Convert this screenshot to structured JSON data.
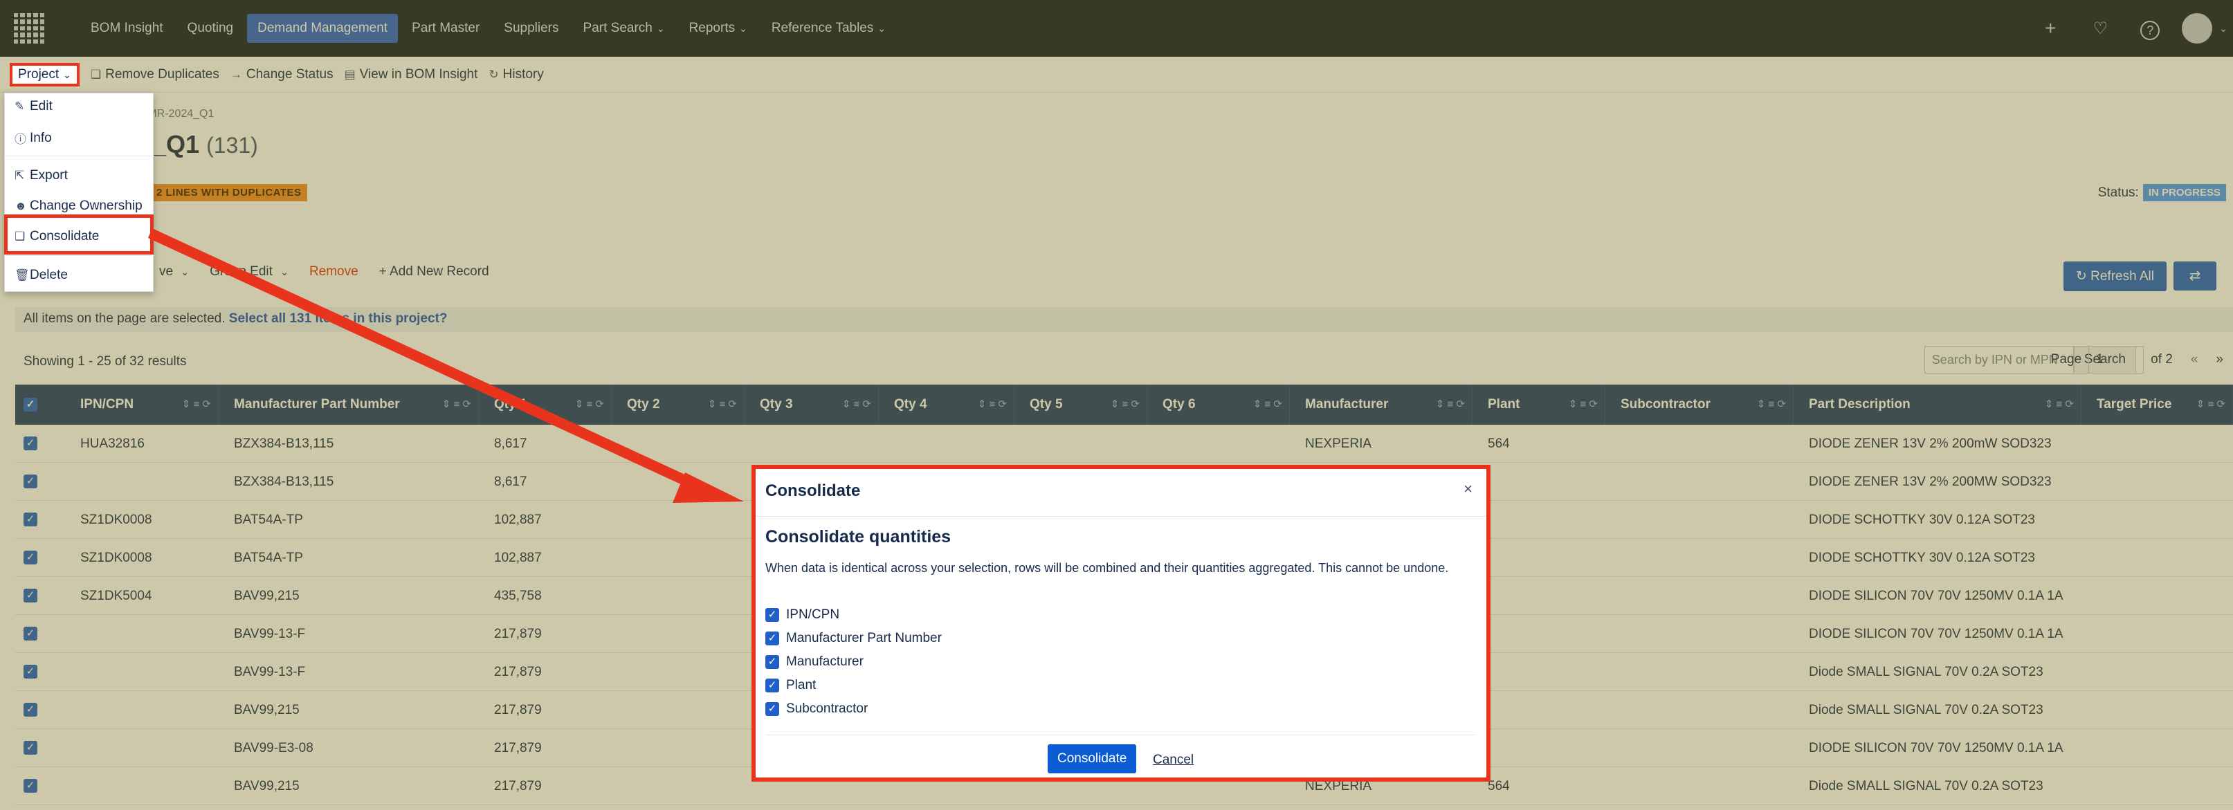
{
  "nav": {
    "items": [
      {
        "label": "BOM Insight",
        "dropdown": false
      },
      {
        "label": "Quoting",
        "dropdown": false
      },
      {
        "label": "Demand Management",
        "dropdown": false,
        "active": true
      },
      {
        "label": "Part Master",
        "dropdown": false
      },
      {
        "label": "Suppliers",
        "dropdown": false
      },
      {
        "label": "Part Search",
        "dropdown": true
      },
      {
        "label": "Reports",
        "dropdown": true
      },
      {
        "label": "Reference Tables",
        "dropdown": true
      }
    ],
    "caret": "⌄",
    "icons": {
      "add": "+",
      "bell": "🔔",
      "help": "?"
    }
  },
  "subbar": {
    "project": "Project",
    "remove_duplicates": "Remove Duplicates",
    "change_status": "Change Status",
    "view_bom": "View in BOM Insight",
    "history": "History"
  },
  "project": {
    "breadcrumb": "MMR-2024_Q1",
    "title": "4_Q1",
    "count": "(131)",
    "duplicates_badge": "2 LINES WITH DUPLICATES",
    "status_label": "Status:",
    "status_value": "IN PROGRESS"
  },
  "dropdown": {
    "edit": "Edit",
    "info": "Info",
    "export": "Export",
    "change_ownership": "Change Ownership",
    "consolidate": "Consolidate",
    "delete": "Delete"
  },
  "grid_toolbar": {
    "move": "ve",
    "group_edit": "Group Edit",
    "remove": "Remove",
    "add_record": "Add New Record",
    "refresh_all": "Refresh All"
  },
  "selection": {
    "message": "All items on the page are selected.",
    "link": "Select all 131 items in this project?"
  },
  "results": {
    "showing": "Showing 1 - 25 of 32 results",
    "search_placeholder": "Search by IPN or MPN",
    "search_button": "Search",
    "page_label": "Page",
    "page_value": "1",
    "page_of": "of 2",
    "prev": "«",
    "next": "»"
  },
  "table": {
    "columns": [
      "IPN/CPN",
      "Manufacturer Part Number",
      "Qty 1",
      "Qty 2",
      "Qty 3",
      "Qty 4",
      "Qty 5",
      "Qty 6",
      "Manufacturer",
      "Plant",
      "Subcontractor",
      "Part Description",
      "Target Price"
    ],
    "rows": [
      {
        "ipn": "HUA32816",
        "mpn": "BZX384-B13,115",
        "qty1": "8,617",
        "mfr": "NEXPERIA",
        "plant": "564",
        "desc": "DIODE ZENER 13V 2% 200mW SOD323"
      },
      {
        "ipn": "",
        "mpn": "BZX384-B13,115",
        "qty1": "8,617",
        "mfr": "",
        "plant": "",
        "desc": "DIODE ZENER 13V 2% 200MW SOD323"
      },
      {
        "ipn": "SZ1DK0008",
        "mpn": "BAT54A-TP",
        "qty1": "102,887",
        "mfr": "",
        "plant": "",
        "desc": "DIODE SCHOTTKY 30V 0.12A SOT23"
      },
      {
        "ipn": "SZ1DK0008",
        "mpn": "BAT54A-TP",
        "qty1": "102,887",
        "mfr": "",
        "plant": "",
        "desc": "DIODE SCHOTTKY 30V 0.12A SOT23"
      },
      {
        "ipn": "SZ1DK5004",
        "mpn": "BAV99,215",
        "qty1": "435,758",
        "mfr": "",
        "plant": "",
        "desc": "DIODE SILICON 70V 70V 1250MV 0.1A 1A"
      },
      {
        "ipn": "",
        "mpn": "BAV99-13-F",
        "qty1": "217,879",
        "mfr": "",
        "plant": "",
        "desc": "DIODE SILICON 70V 70V 1250MV 0.1A 1A"
      },
      {
        "ipn": "",
        "mpn": "BAV99-13-F",
        "qty1": "217,879",
        "mfr": "",
        "plant": "",
        "desc": "Diode SMALL SIGNAL 70V 0.2A SOT23"
      },
      {
        "ipn": "",
        "mpn": "BAV99,215",
        "qty1": "217,879",
        "mfr": "",
        "plant": "",
        "desc": "Diode SMALL SIGNAL 70V 0.2A SOT23"
      },
      {
        "ipn": "",
        "mpn": "BAV99-E3-08",
        "qty1": "217,879",
        "mfr": "",
        "plant": "",
        "desc": "DIODE SILICON 70V 70V 1250MV 0.1A 1A"
      },
      {
        "ipn": "",
        "mpn": "BAV99,215",
        "qty1": "217,879",
        "mfr": "NEXPERIA",
        "plant": "564",
        "desc": "Diode SMALL SIGNAL 70V 0.2A SOT23"
      }
    ]
  },
  "modal": {
    "title": "Consolidate",
    "close": "×",
    "heading": "Consolidate quantities",
    "description": "When data is identical across your selection, rows will be combined and their quantities aggregated. This cannot be undone.",
    "options": [
      "IPN/CPN",
      "Manufacturer Part Number",
      "Manufacturer",
      "Plant",
      "Subcontractor"
    ],
    "confirm": "Consolidate",
    "cancel": "Cancel"
  },
  "colors": {
    "nav_bg": "#0f1a2e",
    "active": "#2b5fcf",
    "primary": "#0b5bd3",
    "highlight": "#e8341c",
    "header": "#1f3b6e",
    "warning": "#f18b2b"
  }
}
